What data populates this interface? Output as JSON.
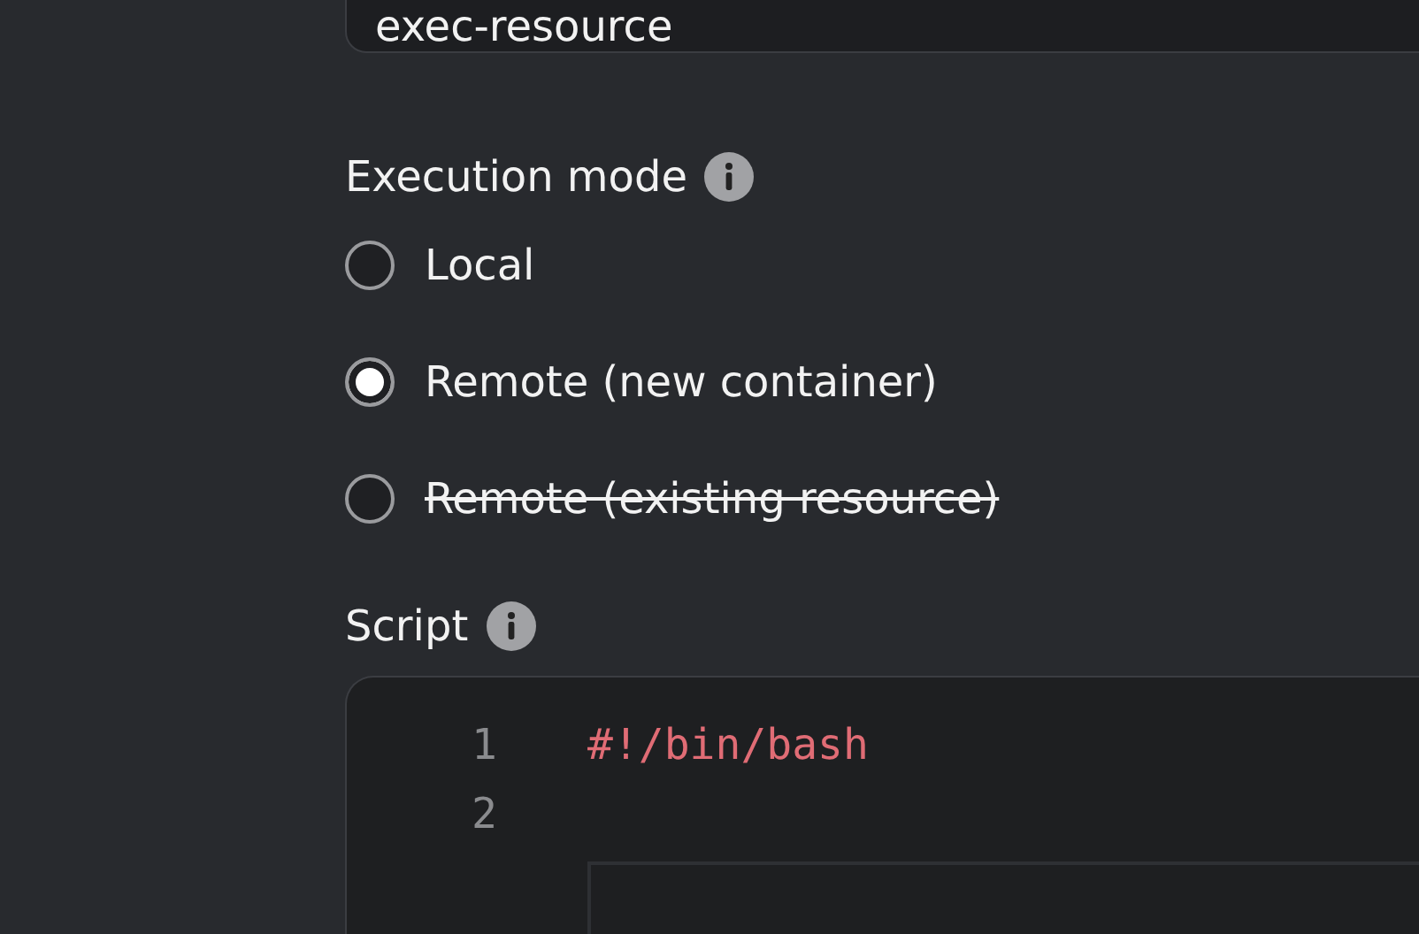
{
  "name_field": {
    "value": "exec-resource"
  },
  "execution_mode": {
    "label": "Execution mode",
    "options": [
      {
        "label": "Local",
        "selected": false,
        "disabled": false
      },
      {
        "label": "Remote (new container)",
        "selected": true,
        "disabled": false
      },
      {
        "label": "Remote (existing resource)",
        "selected": false,
        "disabled": true
      }
    ]
  },
  "script": {
    "label": "Script",
    "lines": [
      {
        "number": "1",
        "code": "#!/bin/bash"
      },
      {
        "number": "2"
      }
    ]
  }
}
